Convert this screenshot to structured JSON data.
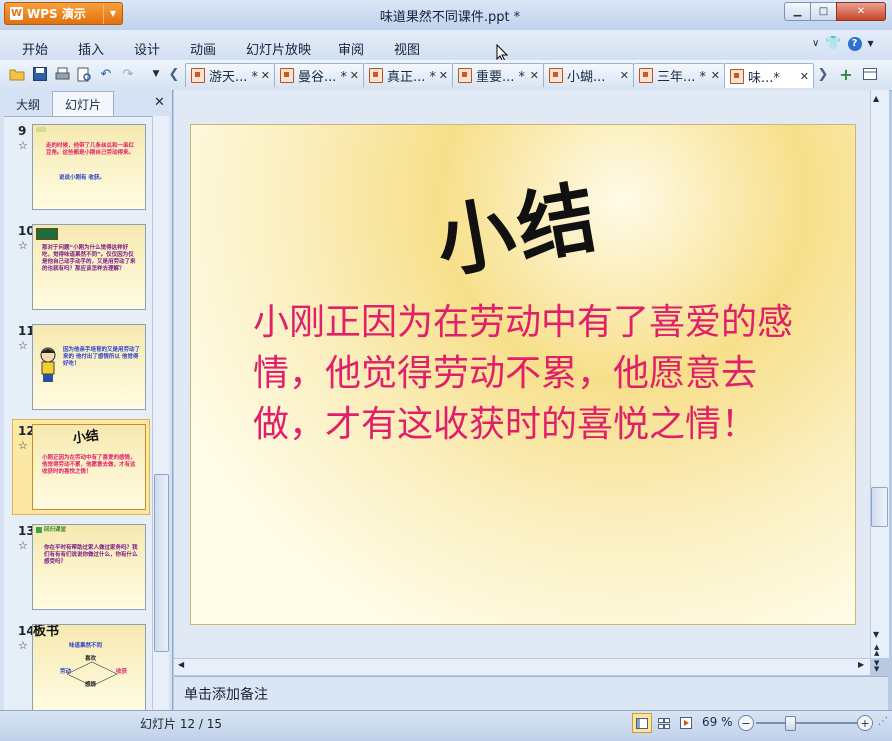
{
  "app": {
    "name": "WPS 演示",
    "logo_glyph": "W"
  },
  "window": {
    "title": "味道果然不同课件.ppt *"
  },
  "menu": [
    "开始",
    "插入",
    "设计",
    "动画",
    "幻灯片放映",
    "审阅",
    "视图"
  ],
  "tabs": [
    {
      "label": "游天... *"
    },
    {
      "label": "曼谷... *"
    },
    {
      "label": "真正... *"
    },
    {
      "label": "重要... *"
    },
    {
      "label": "小蝴..."
    },
    {
      "label": "三年... *"
    },
    {
      "label": "味...*"
    }
  ],
  "left_panel": {
    "tabs": {
      "outline": "大纲",
      "slides": "幻灯片"
    },
    "close": "✕",
    "thumbnails": [
      {
        "num": "9",
        "text": "走的时候，他带了几条丝瓜和一串红豆角。这些都是小刚自己劳动得来。",
        "text2": "说说小刚有 收获。"
      },
      {
        "num": "10",
        "text": "那对于问题“小刚为什么觉得这样好吃，觉得味道果然不同”。仅仅因为仅是他自己动手动手的，又是用劳动了来的也就有吗？那应该怎样去理解？"
      },
      {
        "num": "11",
        "text": "因为他亲手培育的又是用劳动了来的 他付出了感情所以 他觉得好吃！"
      },
      {
        "num": "12",
        "title": "小结",
        "text": "小刚正因为在劳动中有了喜爱的感情，他觉得劳动不累，他愿意去做，才有这收获时的喜悦之情！"
      },
      {
        "num": "13",
        "header": "回归课堂",
        "text": "你在平时有帮助过家人做过家务吗？我们有有有们说说你做过什么，你有什么感受吗？"
      },
      {
        "num": "14",
        "title": "板书",
        "text": "味道果然不同",
        "labels": [
          "喜欢",
          "劳动",
          "收获",
          "感情"
        ]
      }
    ]
  },
  "slide": {
    "title": "小结",
    "body": "小刚正因为在劳动中有了喜爱的感情，他觉得劳动不累，他愿意去做，才有这收获时的喜悦之情！",
    "body_color": "#e0206a"
  },
  "notes_placeholder": "单击添加备注",
  "status": {
    "slide_counter": "幻灯片 12 / 15",
    "zoom": "69 %"
  }
}
